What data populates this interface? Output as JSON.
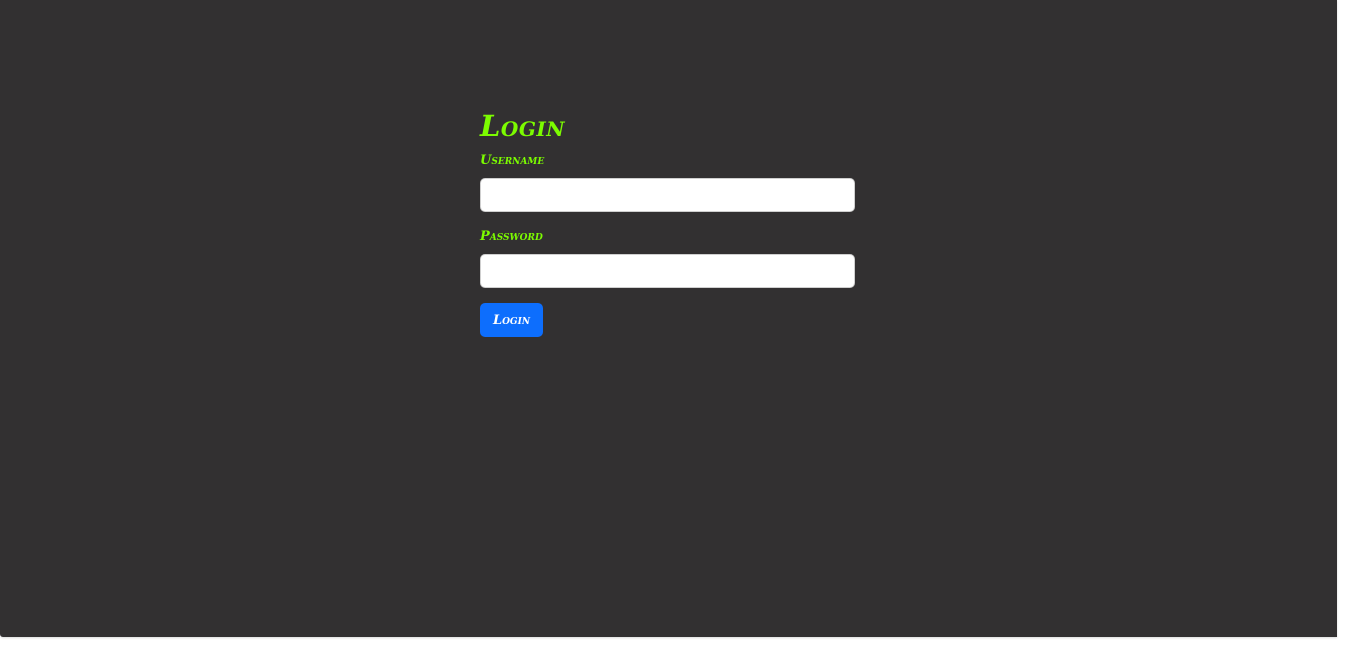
{
  "login": {
    "title": "Login",
    "username_label": "Username",
    "username_value": "",
    "password_label": "Password",
    "password_value": "",
    "submit_label": "Login"
  },
  "colors": {
    "background": "#323031",
    "accent_text": "#7cfc00",
    "button": "#0d6efd",
    "button_text": "#ffffff"
  }
}
